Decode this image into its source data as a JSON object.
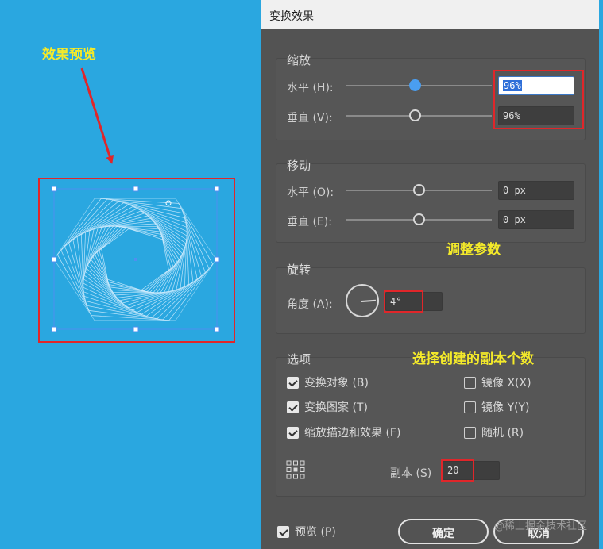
{
  "annotations": {
    "preview": "效果预览",
    "adjust_params": "调整参数",
    "choose_copies": "选择创建的副本个数"
  },
  "dialog": {
    "title": "变换效果",
    "scale": {
      "group": "缩放",
      "horizontal_label": "水平 (H):",
      "horizontal_value": "96%",
      "vertical_label": "垂直 (V):",
      "vertical_value": "96%"
    },
    "move": {
      "group": "移动",
      "horizontal_label": "水平 (O):",
      "horizontal_value": "0 px",
      "vertical_label": "垂直 (E):",
      "vertical_value": "0 px"
    },
    "rotate": {
      "group": "旋转",
      "angle_label": "角度 (A):",
      "angle_value": "4°"
    },
    "options": {
      "group": "选项",
      "transform_objects": "变换对象 (B)",
      "transform_patterns": "变换图案 (T)",
      "scale_strokes": "缩放描边和效果 (F)",
      "reflect_x": "镜像 X(X)",
      "reflect_y": "镜像 Y(Y)",
      "random": "随机 (R)",
      "copies_label": "副本 (S)",
      "copies_value": "20"
    },
    "preview_label": "预览 (P)",
    "ok_label": "确定",
    "cancel_label": "取消"
  },
  "watermark": "@稀土掘金技术社区",
  "colors": {
    "background": "#2aa7e0",
    "dialog": "#535353",
    "annotation": "#f4ea2a",
    "highlight": "#e0262a",
    "slider_active": "#4a9ef0"
  }
}
